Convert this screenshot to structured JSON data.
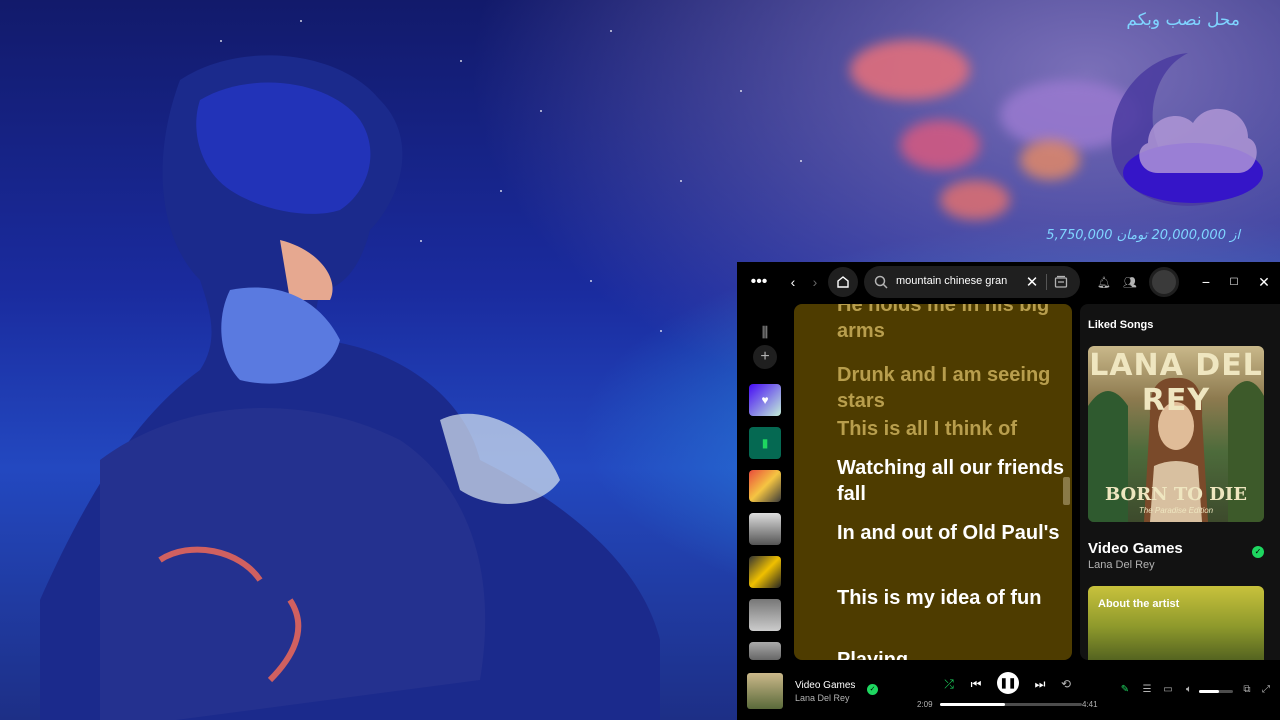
{
  "desktop": {
    "widget_title": "محل نصب وبکم",
    "widget_amount": "5,750,000 از 20,000,000 تومان"
  },
  "spotify": {
    "search": {
      "value": "mountain chinese gran",
      "icon": "search-icon"
    },
    "lyrics": [
      {
        "text": "He holds me in his big arms",
        "active": false
      },
      {
        "text": "Drunk and I am seeing stars",
        "active": false
      },
      {
        "text": "This is all I think of",
        "active": false
      },
      {
        "text": "Watching all our friends fall",
        "active": true
      },
      {
        "text": "In and out of Old Paul's",
        "active": true
      },
      {
        "text": "This is my idea of fun",
        "active": true
      },
      {
        "text": "Playing",
        "active": true
      }
    ],
    "right_panel": {
      "title": "Liked Songs",
      "album_name": "LANA DEL REY",
      "album_sub": "BORN TO DIE",
      "album_sub2": "The Paradise Edition",
      "track_title": "Video Games",
      "track_artist": "Lana Del Rey",
      "about_label": "About the artist"
    },
    "player": {
      "title": "Video Games",
      "artist": "Lana Del Rey",
      "elapsed": "2:09",
      "duration": "4:41",
      "progress_fraction": 0.46,
      "volume_fraction": 0.6
    },
    "colors": {
      "accent": "#1ed760",
      "lyrics_bg": "#4e3c00"
    }
  }
}
